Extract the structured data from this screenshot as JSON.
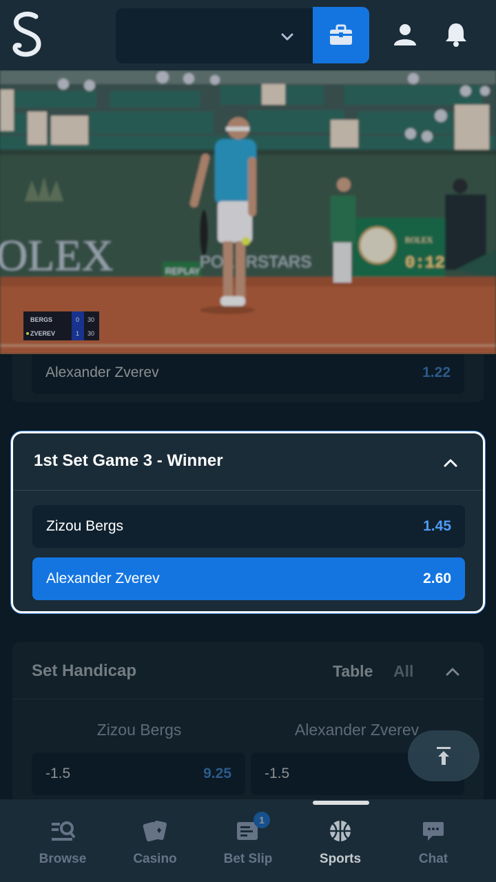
{
  "header": {
    "logo_icon": "stake-s-logo-icon",
    "wallet_chevron_icon": "chevron-down-icon",
    "wallet_icon": "wallet-icon",
    "profile_icon": "user-icon",
    "notifications_icon": "bell-icon"
  },
  "video": {
    "scoreboard": {
      "players": [
        {
          "name": "BERGS",
          "set": "0",
          "points": "30"
        },
        {
          "name": "ZVEREV",
          "set": "1",
          "points": "30"
        }
      ]
    },
    "background_text": {
      "rolex": "OLEX",
      "sponsor": "POKERSTARS",
      "replay": "REPLAY",
      "clock_brand": "ROLEX",
      "clock_time": "0:12"
    }
  },
  "previous_market": {
    "option": {
      "name": "Alexander Zverev",
      "odds": "1.22"
    }
  },
  "focused_market": {
    "title": "1st Set Game 3 - Winner",
    "options": [
      {
        "name": "Zizou Bergs",
        "odds": "1.45",
        "selected": false
      },
      {
        "name": "Alexander Zverev",
        "odds": "2.60",
        "selected": true
      }
    ],
    "colors": {
      "selected": "#1475e1",
      "odds": "#4e9cf5"
    }
  },
  "set_handicap": {
    "title": "Set Handicap",
    "tabs": [
      "Table",
      "All"
    ],
    "columns": [
      "Zizou Bergs",
      "Alexander Zverev"
    ],
    "rows": [
      {
        "left_line": "-1.5",
        "left_odds": "9.25",
        "right_line": "-1.5"
      }
    ]
  },
  "scroll_top_icon": "arrow-up-to-top-icon",
  "bottom_nav": {
    "items": [
      {
        "label": "Browse",
        "icon": "browse-search-icon"
      },
      {
        "label": "Casino",
        "icon": "cards-icon"
      },
      {
        "label": "Bet Slip",
        "icon": "betslip-icon",
        "badge": "1"
      },
      {
        "label": "Sports",
        "icon": "basketball-icon"
      },
      {
        "label": "Chat",
        "icon": "chat-icon"
      }
    ]
  }
}
